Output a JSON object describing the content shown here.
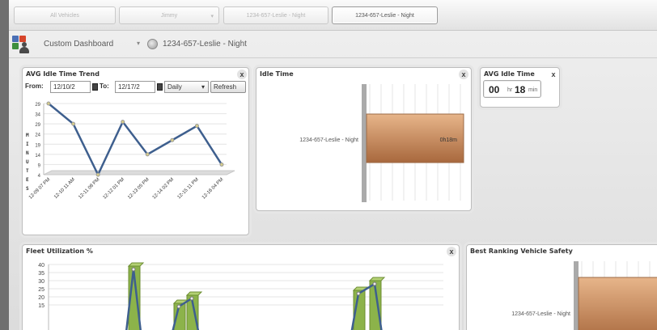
{
  "toolbar": {
    "all_vehicles": "All Vehicles",
    "group": "Jimmy",
    "vehicle_dropdown": "1234-657-Leslie - Night",
    "active_vehicle": "1234-657-Leslie - Night"
  },
  "header": {
    "dashboard_title": "Custom Dashboard",
    "vehicle_title": "1234-657-Leslie - Night"
  },
  "idle_trend": {
    "title": "AVG Idle Time Trend",
    "from_label": "From:",
    "from_value": "12/10/2",
    "to_label": "To:",
    "to_value": "12/17/2",
    "interval": "Daily",
    "refresh": "Refresh",
    "y_axis_letters": [
      "M",
      "I",
      "N",
      "U",
      "T",
      "E",
      "S"
    ],
    "close": "x"
  },
  "idle_time": {
    "title": "Idle Time",
    "close": "x"
  },
  "avg_idle": {
    "title": "AVG Idle Time",
    "close": "x",
    "hours": "00",
    "hours_unit": "hr",
    "minutes": "18",
    "minutes_unit": "min"
  },
  "fleet": {
    "title": "Fleet Utilization %",
    "close": "x"
  },
  "safety": {
    "title": "Best Ranking Vehicle Safety"
  },
  "colors": {
    "line": "#3e5f8e",
    "bar_orange": "#c8895b",
    "bar_green": "#8cb34a"
  },
  "chart_data": [
    {
      "type": "line",
      "x": [
        "12-09 07 PM",
        "12-10 11 AM",
        "12-11 08 PM",
        "12-12 01 PM",
        "12-13 05 PM",
        "12-14 02 PM",
        "12-15 11 PM",
        "12-16 04 PM"
      ],
      "series": [
        {
          "values": [
            39,
            29,
            4,
            30,
            14,
            21,
            28,
            9
          ]
        }
      ],
      "y_ticks": [
        "29",
        "34",
        "29",
        "24",
        "19",
        "14",
        "9",
        "4"
      ],
      "ylabel": "MINUTES",
      "ylim": [
        4,
        39
      ]
    },
    {
      "type": "bar",
      "categories": [
        "1234-657-Leslie - Night"
      ],
      "values": [
        "0h18m"
      ]
    },
    {
      "type": "line",
      "x": [
        "",
        "",
        "",
        "",
        "",
        "",
        "",
        ""
      ],
      "series": [
        {
          "values": [
            null,
            37,
            null,
            14,
            19,
            null,
            22,
            28
          ]
        }
      ],
      "y_ticks": [
        "40",
        "35",
        "30",
        "25",
        "20",
        "15"
      ],
      "ylim": [
        10,
        40
      ]
    },
    {
      "type": "bar",
      "categories": [
        "1234-657-Leslie - Night"
      ]
    }
  ]
}
